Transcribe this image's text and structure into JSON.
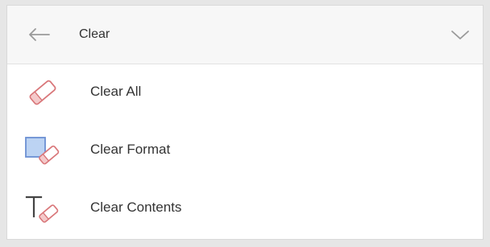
{
  "header": {
    "title": "Clear",
    "back_icon": "back-arrow-icon",
    "collapse_icon": "chevron-down-icon"
  },
  "items": [
    {
      "label": "Clear All",
      "icon": "eraser-icon"
    },
    {
      "label": "Clear Format",
      "icon": "clear-format-icon"
    },
    {
      "label": "Clear Contents",
      "icon": "clear-contents-icon"
    }
  ],
  "colors": {
    "eraser_stroke": "#d9777a",
    "format_fill": "#bcd3f3",
    "format_stroke": "#6b8fd3",
    "text_icon": "#444444"
  }
}
